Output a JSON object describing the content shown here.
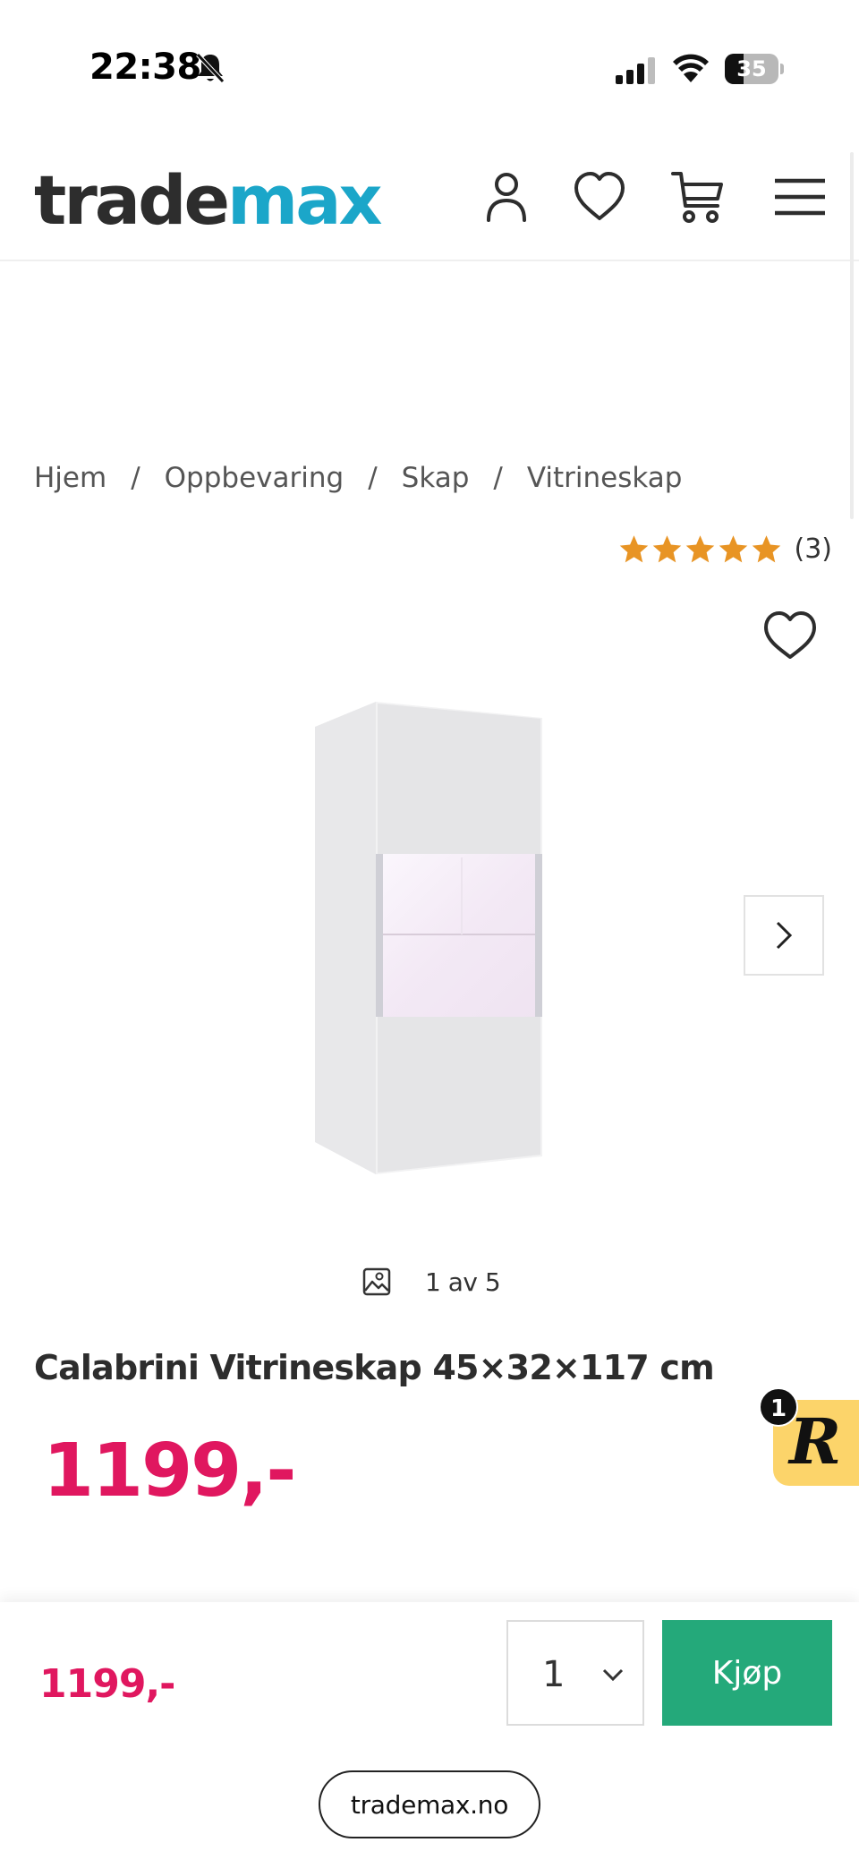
{
  "status_bar": {
    "time": "22:38",
    "battery": "35",
    "battery_level": 0.35
  },
  "header": {
    "logo_dark": "trade",
    "logo_blue": "max",
    "icons": [
      "account-icon",
      "heart-icon",
      "cart-icon",
      "menu-icon"
    ]
  },
  "breadcrumb": {
    "items": [
      "Hjem",
      "Oppbevaring",
      "Skap",
      "Vitrineskap"
    ],
    "separator": "/"
  },
  "rating": {
    "stars": 5,
    "count_label": "(3)"
  },
  "gallery": {
    "counter": "1 av 5"
  },
  "product": {
    "title": "Calabrini Vitrineskap 45×32×117 cm",
    "price": "1199,-"
  },
  "reviews_badge": {
    "letter": "R",
    "count": "1"
  },
  "sticky_bar": {
    "price": "1199,-",
    "quantity": "1",
    "buy_label": "Kjøp"
  },
  "browser": {
    "url": "trademax.no"
  },
  "colors": {
    "brand_blue": "#1ba6c9",
    "price_pink": "#e0175f",
    "buy_green": "#24a97a",
    "star_orange": "#e89424"
  }
}
